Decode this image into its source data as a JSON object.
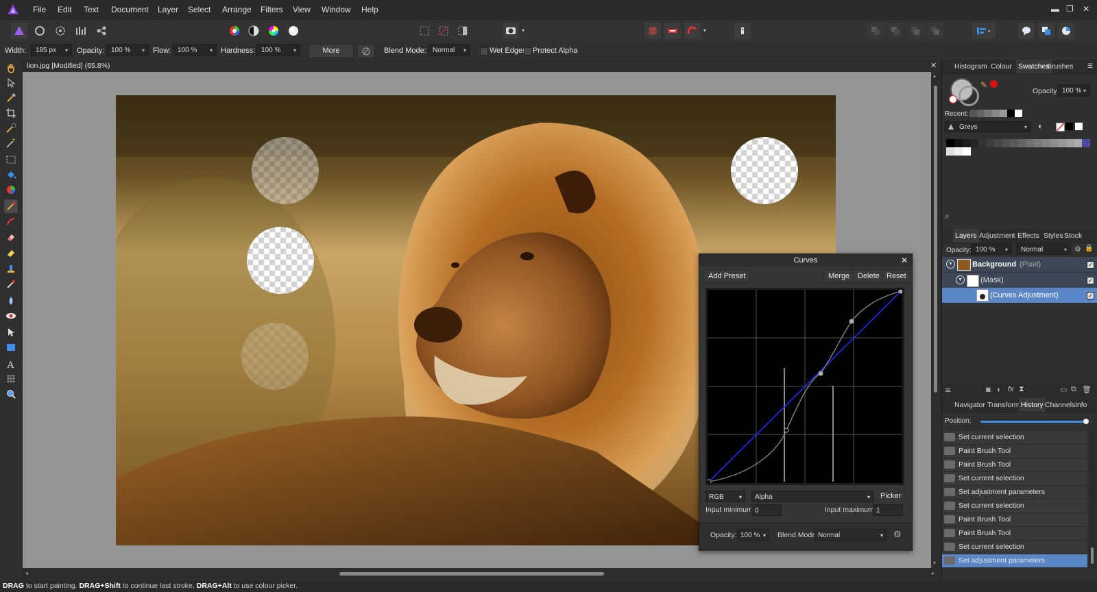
{
  "menu": {
    "items": [
      "File",
      "Edit",
      "Text",
      "Document",
      "Layer",
      "Select",
      "Arrange",
      "Filters",
      "View",
      "Window",
      "Help"
    ]
  },
  "window_controls": {
    "minimize": "▬",
    "restore": "❐",
    "close": "✕"
  },
  "context_bar": {
    "width_label": "Width:",
    "width_value": "185 px",
    "opacity_label": "Opacity:",
    "opacity_value": "100 %",
    "flow_label": "Flow:",
    "flow_value": "100 %",
    "hardness_label": "Hardness:",
    "hardness_value": "100 %",
    "more_label": "More",
    "blend_label": "Blend Mode:",
    "blend_value": "Normal",
    "wet_edges_label": "Wet Edges",
    "protect_alpha_label": "Protect Alpha"
  },
  "document": {
    "title": "lion.jpg [Modified] (65.8%)",
    "close": "✕"
  },
  "status": {
    "k1": "DRAG",
    "t1": " to start painting. ",
    "k2": "DRAG+Shift",
    "t2": " to continue last stroke. ",
    "k3": "DRAG+Alt",
    "t3": " to use colour picker."
  },
  "top_panel": {
    "tabs": [
      "Histogram",
      "Colour",
      "Swatches",
      "Brushes"
    ],
    "opacity_label": "Opacity:",
    "opacity_value": "100 %",
    "recent_label": "Recent:",
    "palette_name": "Greys",
    "primary_color": "#bdbdbd",
    "accent_red": "#e01010"
  },
  "layers_panel": {
    "tabs": [
      "Layers",
      "Adjustment",
      "Effects",
      "Styles",
      "Stock"
    ],
    "opacity_label": "Opacity:",
    "opacity_value": "100 %",
    "blend_value": "Normal",
    "layers": [
      {
        "name": "Background",
        "type": "(Pixel)"
      },
      {
        "name": "(Mask)"
      },
      {
        "name": "(Curves Adjustment)"
      }
    ],
    "selection_color": "#5a86c6"
  },
  "history_panel": {
    "tabs": [
      "Navigator",
      "Transform",
      "History",
      "Channels",
      "Info"
    ],
    "position_label": "Position:",
    "items": [
      "Set current selection",
      "Paint Brush Tool",
      "Paint Brush Tool",
      "Set current selection",
      "Set adjustment parameters",
      "Set current selection",
      "Paint Brush Tool",
      "Paint Brush Tool",
      "Set current selection",
      "Set adjustment parameters"
    ],
    "selected_index": 9
  },
  "curves_dialog": {
    "title": "Curves",
    "close": "✕",
    "add_preset": "Add Preset",
    "merge": "Merge",
    "delete": "Delete",
    "reset": "Reset",
    "channel": "RGB",
    "component": "Alpha",
    "picker": "Picker",
    "input_min_label": "Input minimum:",
    "input_min_value": "0",
    "input_max_label": "Input maximum:",
    "input_max_value": "1",
    "opacity_label": "Opacity:",
    "opacity_value": "100 %",
    "blend_label": "Blend Mode:",
    "blend_value": "Normal",
    "curve_color": "#8a8a8a",
    "diagonal_color": "#2a2aff"
  }
}
